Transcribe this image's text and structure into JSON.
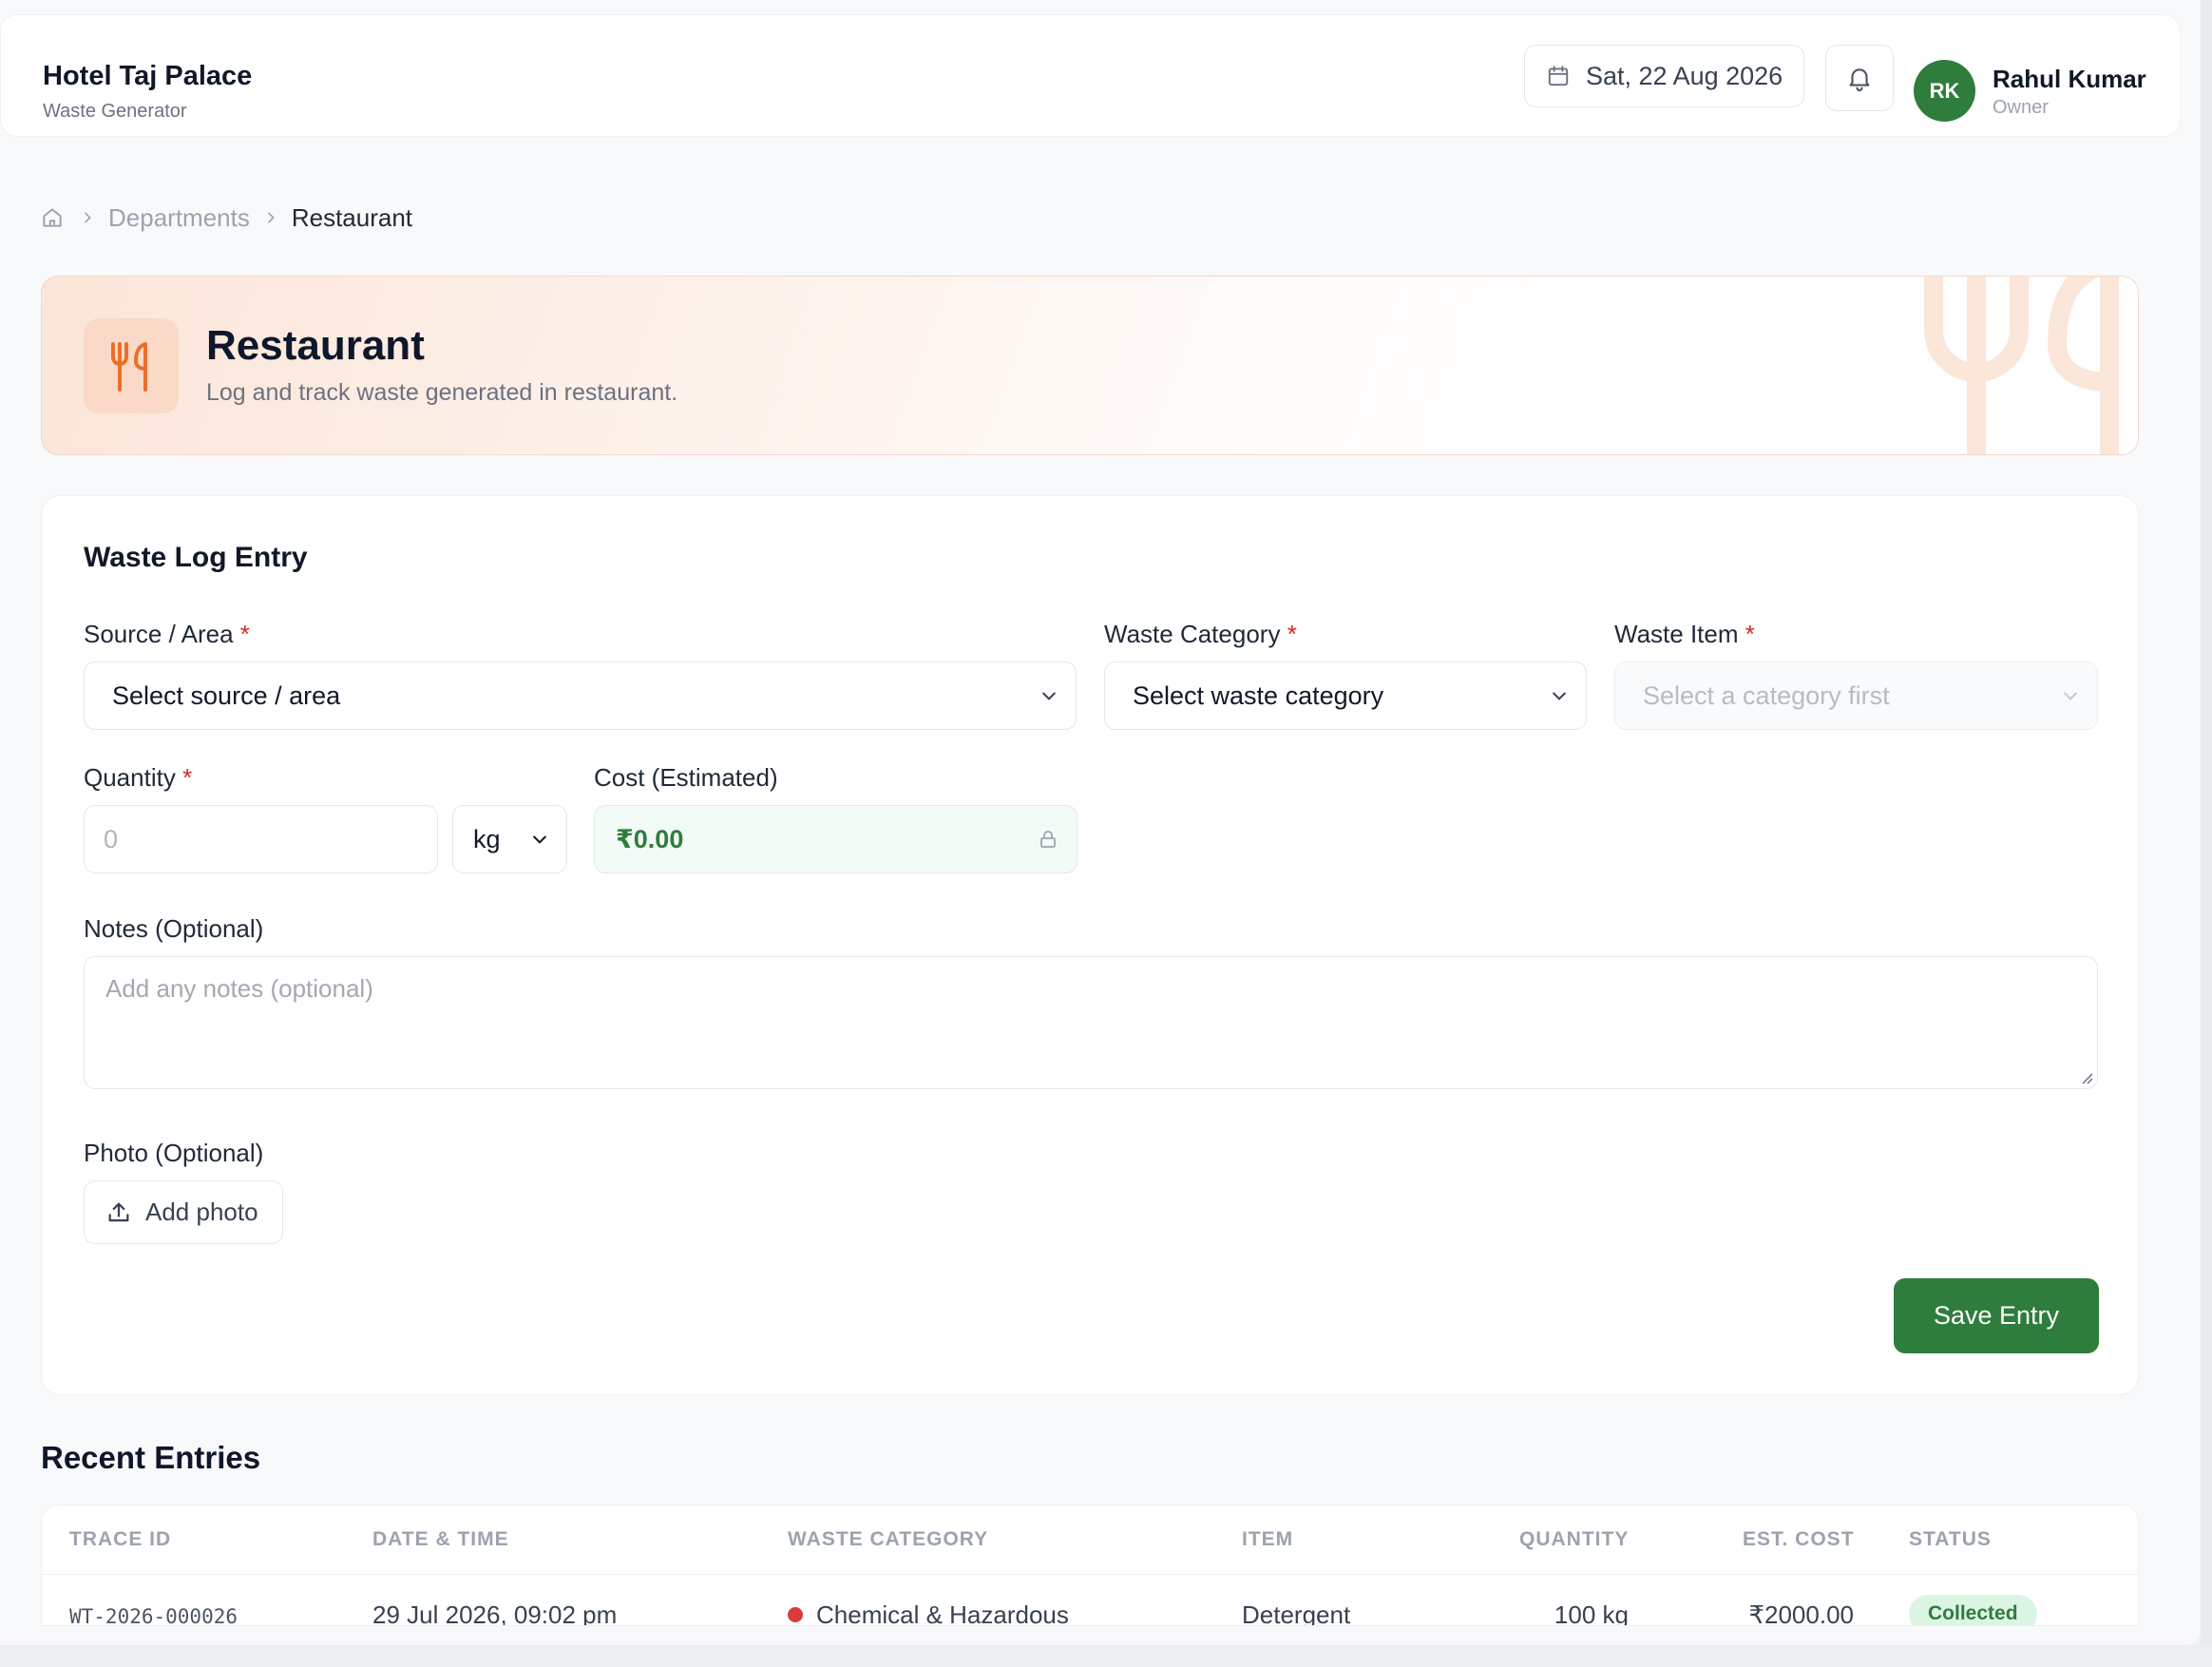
{
  "header": {
    "hotel_name": "Hotel Taj Palace",
    "role_label": "Waste Generator",
    "date": "Sat, 22 Aug 2026",
    "user": {
      "initials": "RK",
      "name": "Rahul Kumar",
      "role": "Owner"
    }
  },
  "breadcrumb": {
    "parent": "Departments",
    "current": "Restaurant"
  },
  "hero": {
    "title": "Restaurant",
    "subtitle": "Log and track waste generated in restaurant."
  },
  "form": {
    "title": "Waste Log Entry",
    "source": {
      "label": "Source / Area",
      "required": "*",
      "value": "Select source / area"
    },
    "category": {
      "label": "Waste Category",
      "required": "*",
      "value": "Select waste category"
    },
    "item": {
      "label": "Waste Item",
      "required": "*",
      "value": "Select a category first"
    },
    "quantity": {
      "label": "Quantity",
      "required": "*",
      "placeholder": "0",
      "unit": "kg"
    },
    "cost": {
      "label": "Cost (Estimated)",
      "value": "₹0.00"
    },
    "notes": {
      "label": "Notes (Optional)",
      "placeholder": "Add any notes (optional)"
    },
    "photo": {
      "label": "Photo (Optional)",
      "button": "Add photo"
    },
    "save": "Save Entry"
  },
  "recent": {
    "title": "Recent Entries",
    "columns": [
      "TRACE ID",
      "DATE & TIME",
      "WASTE CATEGORY",
      "ITEM",
      "QUANTITY",
      "EST. COST",
      "STATUS"
    ],
    "rows": [
      {
        "trace_id": "WT-2026-000026",
        "datetime": "29 Jul 2026, 09:02 pm",
        "category": "Chemical & Hazardous",
        "item": "Detergent",
        "quantity": "100 kg",
        "cost": "₹2000.00",
        "status": "Collected"
      }
    ]
  },
  "colors": {
    "accent": "#2f7d3c",
    "hero_icon": "#e8702a",
    "hazard_dot": "#dc3b3b"
  }
}
